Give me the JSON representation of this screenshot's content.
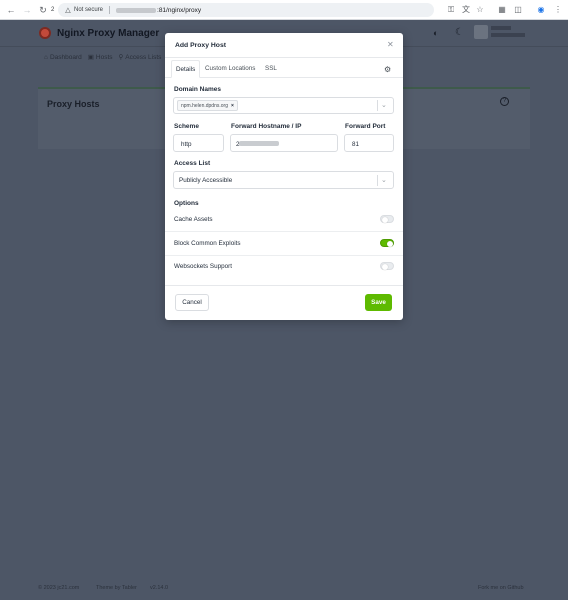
{
  "browser": {
    "reload_count": "2",
    "security_label": "Not secure",
    "url_tail": ":81/nginx/proxy"
  },
  "app": {
    "brand": "Nginx Proxy Manager",
    "nav": [
      "Dashboard",
      "Hosts",
      "Access Lists"
    ],
    "card_title": "Proxy Hosts",
    "footer_left": "© 2023 jc21.com",
    "footer_theme": "Theme by Tabler",
    "footer_version": "v2.14.0",
    "footer_right": "Fork me on Github"
  },
  "modal": {
    "title": "Add Proxy Host",
    "tabs": [
      "Details",
      "Custom Locations",
      "SSL"
    ],
    "domain_names_label": "Domain Names",
    "domain_chip": "npm.helen.dpdns.org",
    "scheme_label": "Scheme",
    "scheme_value": "http",
    "forward_host_label": "Forward Hostname / IP",
    "forward_host_prefix": "2",
    "forward_port_label": "Forward Port",
    "forward_port_value": "81",
    "access_list_label": "Access List",
    "access_list_value": "Publicly Accessible",
    "options_label": "Options",
    "options": [
      {
        "label": "Cache Assets",
        "enabled": false
      },
      {
        "label": "Block Common Exploits",
        "enabled": true
      },
      {
        "label": "Websockets Support",
        "enabled": false
      }
    ],
    "cancel_label": "Cancel",
    "save_label": "Save"
  },
  "colors": {
    "accent_green": "#5eba00",
    "overlay": "#4d5666"
  }
}
